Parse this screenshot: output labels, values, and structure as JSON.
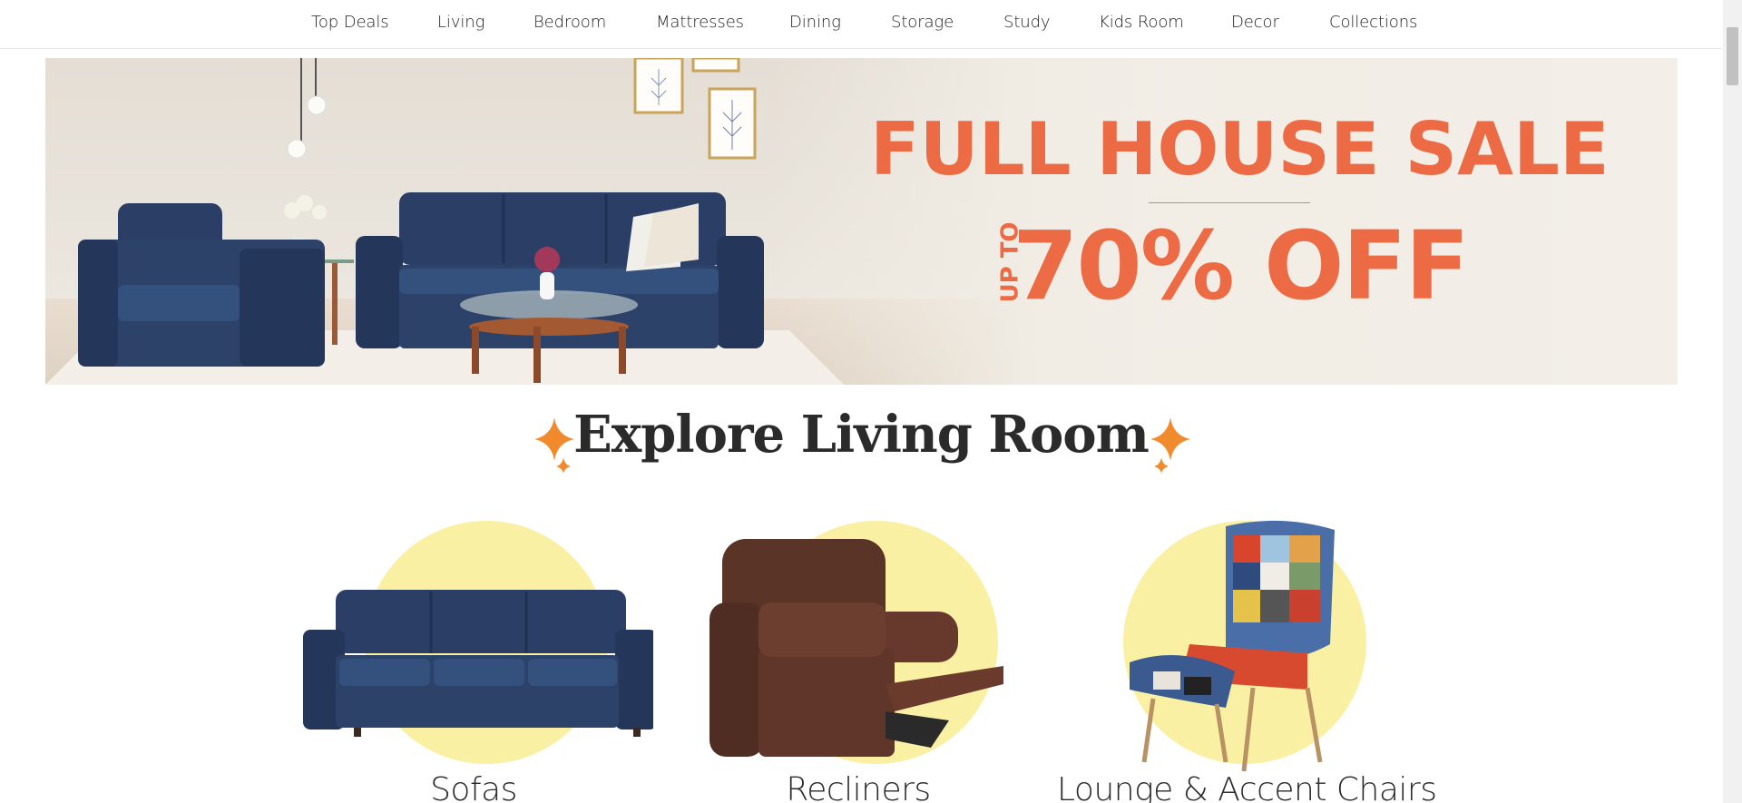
{
  "nav": {
    "items": [
      {
        "label": "Top Deals"
      },
      {
        "label": "Living"
      },
      {
        "label": "Bedroom"
      },
      {
        "label": "Mattresses"
      },
      {
        "label": "Dining"
      },
      {
        "label": "Storage"
      },
      {
        "label": "Study"
      },
      {
        "label": "Kids Room"
      },
      {
        "label": "Decor"
      },
      {
        "label": "Collections"
      }
    ]
  },
  "banner": {
    "title": "FULL HOUSE SALE",
    "up_to": "UP TO",
    "discount": "70% OFF",
    "accent_color": "#ec6b44"
  },
  "explore": {
    "title": "Explore Living Room",
    "sparkle_color": "#f08a2c"
  },
  "categories": [
    {
      "label": "Sofas",
      "icon": "sofa-image"
    },
    {
      "label": "Recliners",
      "icon": "recliner-image"
    },
    {
      "label": "Lounge & Accent Chairs",
      "icon": "accent-chair-image"
    }
  ],
  "colors": {
    "circle": "#faf0a4",
    "sofa_blue": "#2b3f66",
    "recliner_brown": "#5b3428"
  }
}
